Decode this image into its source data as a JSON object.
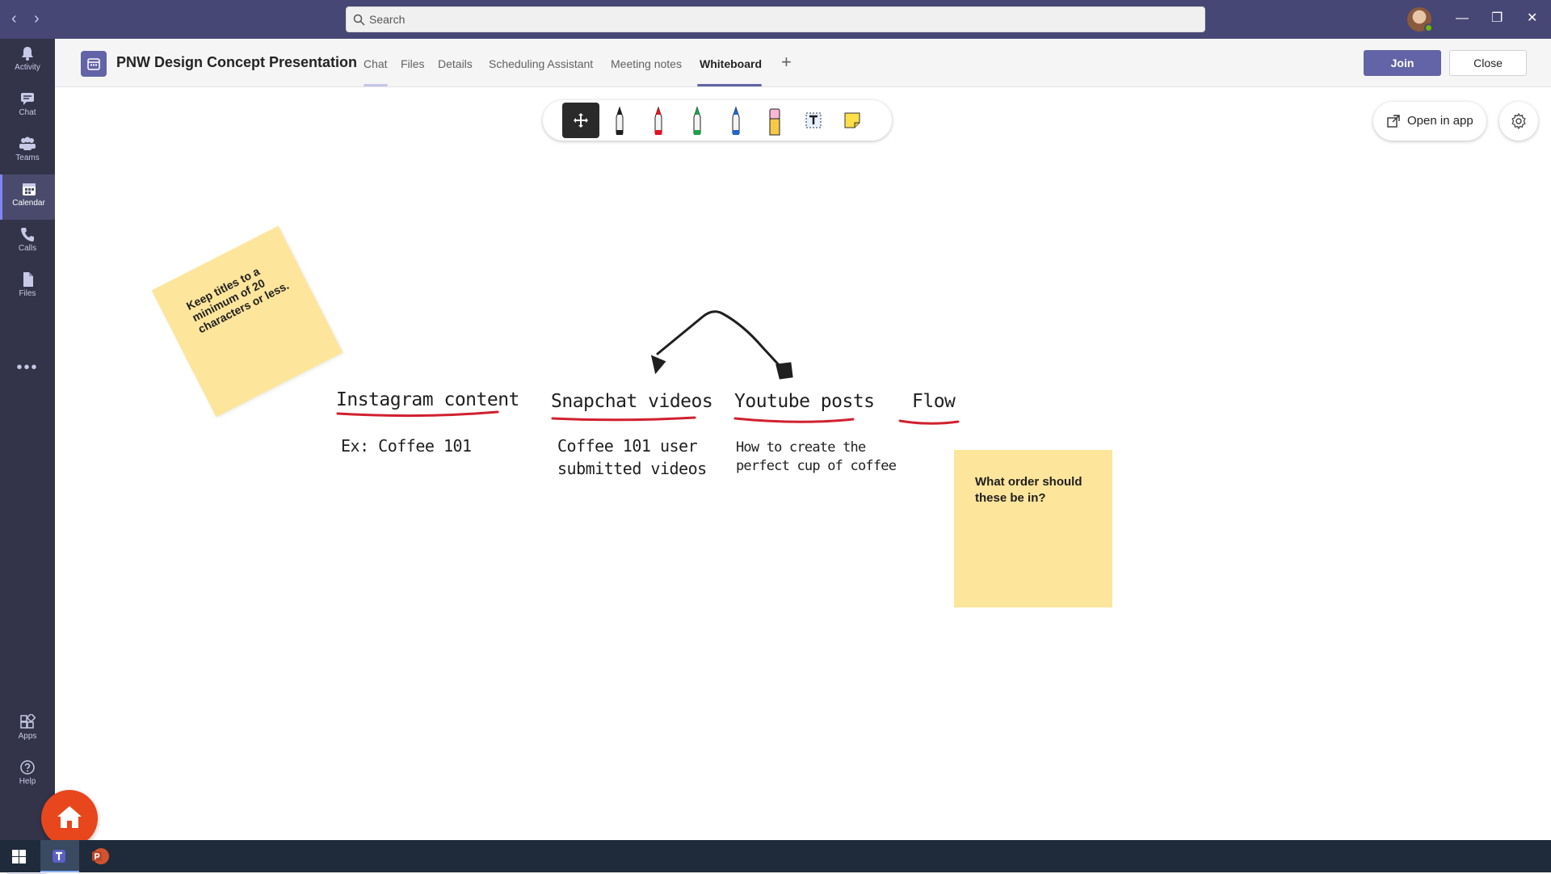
{
  "topbar": {
    "search_placeholder": "Search",
    "back_glyph": "‹",
    "forward_glyph": "›",
    "minimize_glyph": "—",
    "restore_glyph": "❐",
    "close_glyph": "✕"
  },
  "rail": {
    "items": [
      {
        "label": "Activity",
        "icon": "bell-icon"
      },
      {
        "label": "Chat",
        "icon": "chat-icon"
      },
      {
        "label": "Teams",
        "icon": "teams-icon"
      },
      {
        "label": "Calendar",
        "icon": "calendar-icon",
        "active": true
      },
      {
        "label": "Calls",
        "icon": "phone-icon"
      },
      {
        "label": "Files",
        "icon": "file-icon"
      }
    ],
    "more": "•••",
    "bottom": [
      {
        "label": "Apps",
        "icon": "apps-icon"
      },
      {
        "label": "Help",
        "icon": "help-icon"
      }
    ]
  },
  "header": {
    "title": "PNW Design Concept Presentation",
    "tabs": [
      "Chat",
      "Files",
      "Details",
      "Scheduling Assistant",
      "Meeting notes",
      "Whiteboard"
    ],
    "active_tab": "Whiteboard",
    "add_tab": "+",
    "join_label": "Join",
    "close_label": "Close"
  },
  "whiteboard": {
    "open_in_app": "Open in app",
    "tools": [
      {
        "name": "move-tool",
        "color": "#ffffff"
      },
      {
        "name": "black-pen",
        "color": "#1f1f1f"
      },
      {
        "name": "red-pen",
        "color": "#e81123"
      },
      {
        "name": "green-pen",
        "color": "#16a34a"
      },
      {
        "name": "blue-pen",
        "color": "#1e66d0"
      },
      {
        "name": "highlighter",
        "color": "#f9b7d6"
      },
      {
        "name": "text-tool",
        "color": "#1f1f1f"
      },
      {
        "name": "sticky-note-tool",
        "color": "#fde047"
      }
    ],
    "sticky_1": "Keep titles to a minimum of 20 characters or less.",
    "sticky_2": "What order should these be in?",
    "headings": [
      "Instagram content",
      "Snapchat videos",
      "Youtube posts",
      "Flow"
    ],
    "notes": {
      "instagram": "Ex: Coffee 101",
      "snapchat_1": "Coffee 101 user",
      "snapchat_2": "submitted videos",
      "youtube_1": "How to create the",
      "youtube_2": "perfect cup of coffee"
    },
    "ink_color": "#1f1f1f",
    "underline_color": "#d1202f"
  },
  "colors": {
    "brand": "#6264a7",
    "topbar": "#464775",
    "rail": "#33344a",
    "sticky": "#fde59b"
  }
}
